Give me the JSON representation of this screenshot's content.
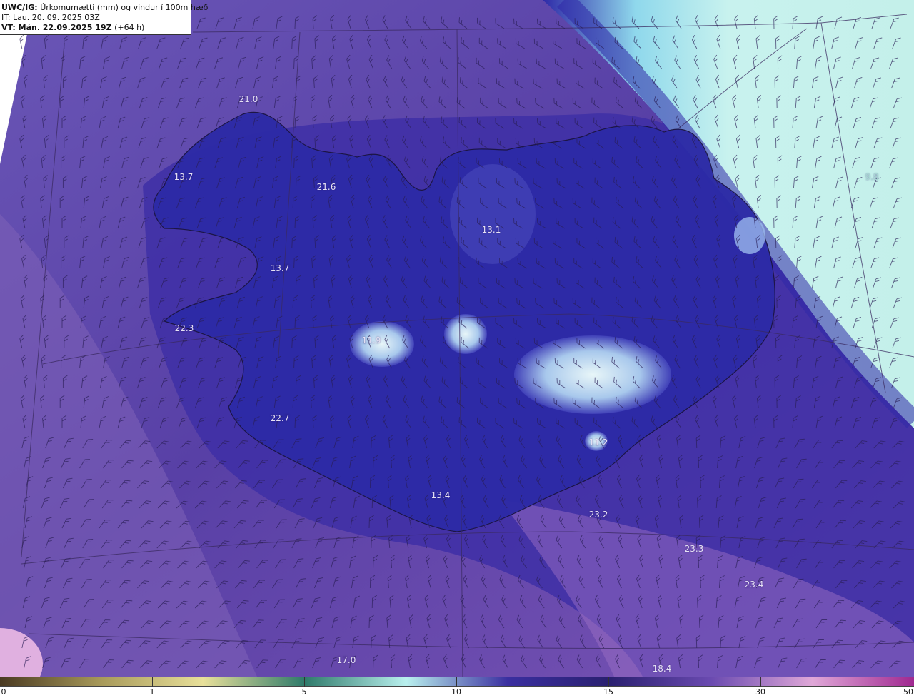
{
  "header": {
    "model_label": "UWC/IG:",
    "title": "Úrkomumætti (mm) og vindur í 100m hæð",
    "issue_time": "IT: Lau. 20. 09. 2025 03Z",
    "valid_time_label": "VT: Mán. 22.09.2025 19Z",
    "valid_time_offset": "(+64 h)"
  },
  "map_values": [
    "21.0",
    "13.7",
    "21.6",
    "13.1",
    "13.7",
    "22.3",
    "11.9",
    "9.8",
    "22.7",
    "11.2",
    "13.4",
    "23.2",
    "23.3",
    "23.4",
    "17.0",
    "18.4"
  ],
  "colorbar": {
    "ticks": [
      "0",
      "1",
      "5",
      "10",
      "15",
      "30",
      "50"
    ],
    "colors": [
      "#4a3a22",
      "#a89a5a",
      "#e8e09a",
      "#2e7a6a",
      "#b9f0ee",
      "#3a2fa0",
      "#2a2070",
      "#6a4ab0",
      "#e0a8d8",
      "#a02890"
    ]
  },
  "legend_colors": {
    "background": "#5e4aa8",
    "water_high": "#c6f2ee",
    "land_dark": "#2f27a8"
  }
}
